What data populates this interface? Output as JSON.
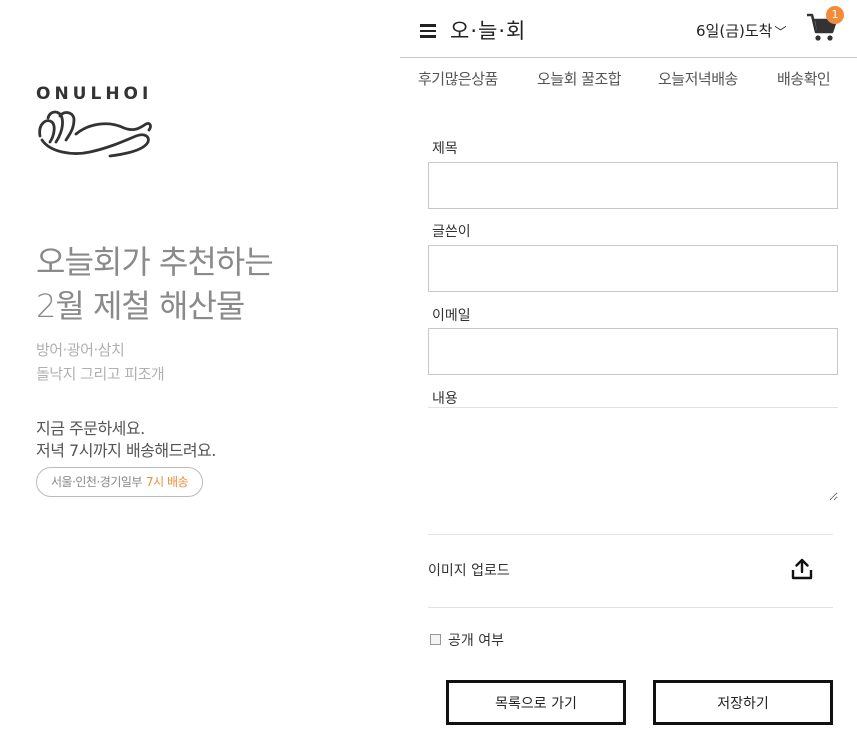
{
  "left": {
    "logo_text": "ONULHOI",
    "headline": [
      "오늘회가 추천하는",
      "2월 제철 해산물"
    ],
    "sub": [
      "방어·광어·삼치",
      "돌낙지 그리고 피조개"
    ],
    "order": [
      "지금 주문하세요.",
      "저녁 7시까지 배송해드려요."
    ],
    "pill_text": "서울·인천·경기일부",
    "pill_highlight": "7시 배송",
    "accent_color": "#f08c3a"
  },
  "header": {
    "brand": "오·늘·회",
    "delivery": "6일(금)도착",
    "cart_count": "1",
    "menu_icon": "hamburger-icon",
    "cart_icon": "cart-icon"
  },
  "nav": [
    "후기많은상품",
    "오늘회 꿀조합",
    "오늘저녁배송",
    "배송확인"
  ],
  "form": {
    "title_label": "제목",
    "author_label": "글쓴이",
    "email_label": "이메일",
    "content_label": "내용",
    "title_value": "",
    "author_value": "",
    "email_value": "",
    "content_value": "",
    "upload_label": "이미지 업로드",
    "public_label": "공개 여부",
    "back_button": "목록으로 가기",
    "save_button": "저장하기"
  }
}
